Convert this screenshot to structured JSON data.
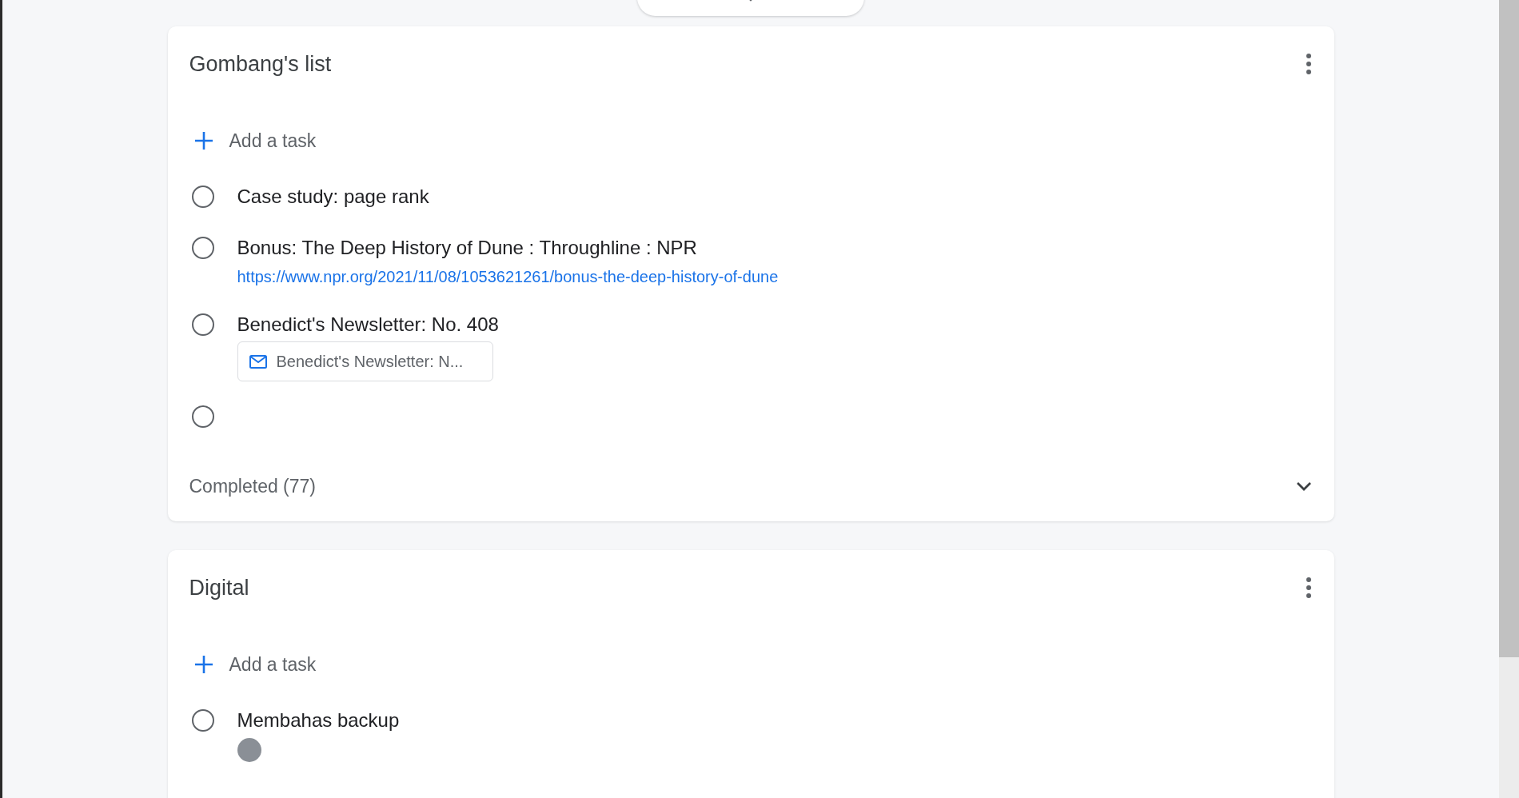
{
  "lists": [
    {
      "title": "Gombang's list",
      "add_label": "Add a task",
      "completed_label": "Completed (77)",
      "tasks": [
        {
          "kind": "plain",
          "title": "Case study: page rank",
          "checked": false
        },
        {
          "kind": "link",
          "title": "Bonus: The Deep History of Dune : Throughline : NPR",
          "link": "https://www.npr.org/2021/11/08/1053621261/bonus-the-deep-history-of-dune",
          "checked": false
        },
        {
          "kind": "email",
          "title": "Benedict's Newsletter: No. 408",
          "attachment": "Benedict's Newsletter: N...",
          "checked": false
        },
        {
          "kind": "plain",
          "checked": false
        }
      ]
    },
    {
      "title": "Digital",
      "add_label": "Add a task",
      "tasks": [
        {
          "kind": "assignee",
          "title": "Membahas backup",
          "checked": false
        }
      ]
    }
  ]
}
